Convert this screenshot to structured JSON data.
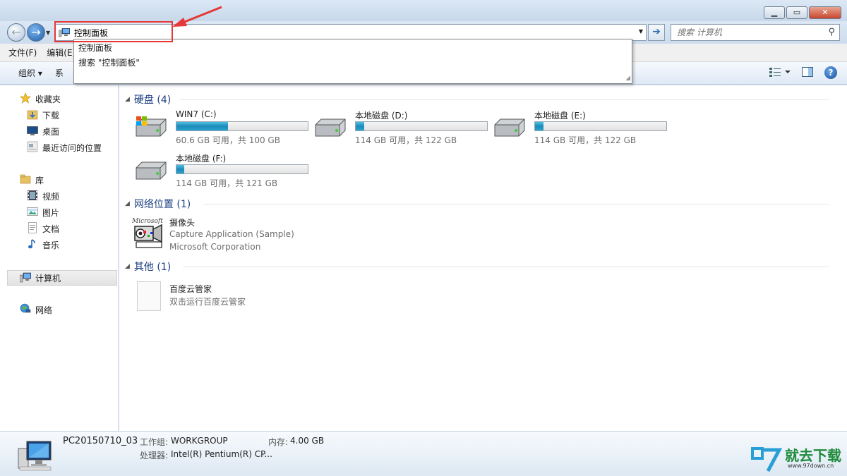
{
  "window": {
    "controls": {
      "minimize": "▁",
      "maximize": "▭",
      "close": "✕"
    }
  },
  "address": {
    "value": "控制面板",
    "suggestions": [
      "控制面板",
      "搜索 \"控制面板\""
    ]
  },
  "search": {
    "placeholder": "搜索 计算机"
  },
  "menu": {
    "items": [
      "文件(F)",
      "编辑(E)"
    ]
  },
  "toolbar": {
    "organize": "组织 ▾",
    "system_partial": "系"
  },
  "sidebar": {
    "favorites_label": "收藏夹",
    "favorites": [
      "下载",
      "桌面",
      "最近访问的位置"
    ],
    "libraries_label": "库",
    "libraries": [
      "视频",
      "图片",
      "文档",
      "音乐"
    ],
    "computer_label": "计算机",
    "network_label": "网络"
  },
  "sections": {
    "hdd": "硬盘 (4)",
    "network": "网络位置 (1)",
    "other": "其他 (1)"
  },
  "drives": [
    {
      "name": "WIN7 (C:)",
      "info": "60.6 GB 可用，共 100 GB",
      "used_fraction": 0.394
    },
    {
      "name": "本地磁盘 (D:)",
      "info": "114 GB 可用，共 122 GB",
      "used_fraction": 0.066
    },
    {
      "name": "本地磁盘 (E:)",
      "info": "114 GB 可用，共 122 GB",
      "used_fraction": 0.066
    },
    {
      "name": "本地磁盘 (F:)",
      "info": "114 GB 可用，共 121 GB",
      "used_fraction": 0.058
    }
  ],
  "network_item": {
    "name": "摄像头",
    "line2": "Capture Application (Sample)",
    "line3": "Microsoft Corporation",
    "logo_text": "Microsoft"
  },
  "other_item": {
    "name": "百度云管家",
    "desc": "双击运行百度云管家"
  },
  "details": {
    "pc_name": "PC20150710_03",
    "workgroup_label": "工作组:",
    "workgroup": "WORKGROUP",
    "memory_label": "内存:",
    "memory": "4.00 GB",
    "cpu_label": "处理器:",
    "cpu": "Intel(R) Pentium(R) CP..."
  },
  "watermark": {
    "brand": "就去下载",
    "url": "www.97down.cn"
  },
  "colors": {
    "highlight": "#e63838",
    "drive_fill": "#2aa3cf",
    "section": "#1e3f82"
  }
}
